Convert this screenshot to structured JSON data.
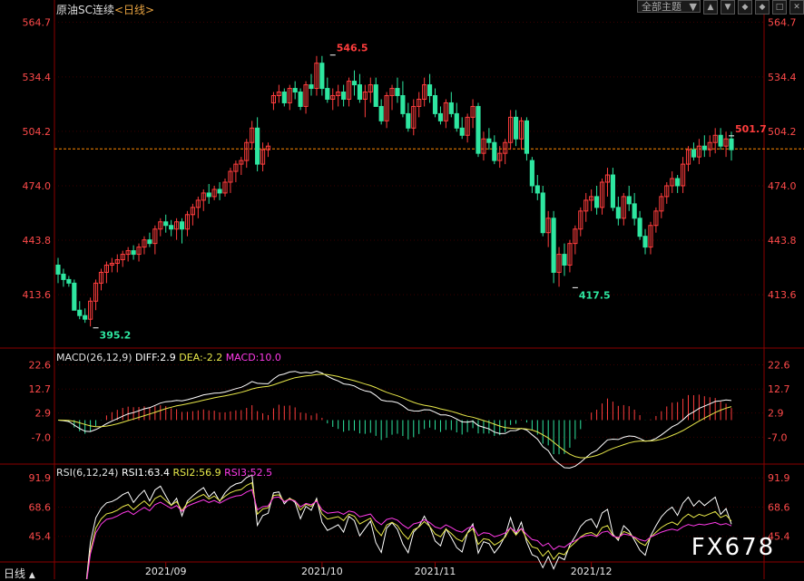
{
  "header": {
    "instrument": "原油SC连续",
    "period": "<日线>",
    "theme_select": "全部主题",
    "theme_arrow": "▼",
    "buttons": [
      "▲",
      "▼",
      "◆",
      "◆",
      "□",
      "✕"
    ]
  },
  "period_tab": "日线",
  "watermark": "FX678",
  "colors": {
    "up": "#ff3d3d",
    "down": "#2ee6a0",
    "bg": "#000000",
    "grid": "#3a0000",
    "axis_text": "#ff4a4a",
    "last_price_line": "#ff8a00"
  },
  "chart_data": [
    {
      "type": "candlestick",
      "title": "原油SC连续<日线>",
      "y_ticks": [
        564.7,
        534.4,
        504.2,
        474.0,
        443.8,
        413.6
      ],
      "ylim": [
        384.0,
        570.0
      ],
      "x_labels": [
        "2021/09",
        "2021/10",
        "2021/11",
        "2021/12"
      ],
      "x_label_index": [
        20,
        49,
        70,
        99
      ],
      "annotations": [
        {
          "text": "546.5",
          "index": 51,
          "value": 546.5,
          "kind": "high"
        },
        {
          "text": "395.2",
          "index": 7,
          "value": 395.2,
          "kind": "low"
        },
        {
          "text": "417.5",
          "index": 96,
          "value": 417.5,
          "kind": "low"
        },
        {
          "text": "501.7",
          "index": 125,
          "value": 501.7,
          "kind": "high"
        }
      ],
      "last_price": 494.5,
      "candles": [
        [
          430,
          434,
          420,
          425
        ],
        [
          425,
          428,
          418,
          422
        ],
        [
          422,
          424,
          418,
          420
        ],
        [
          420,
          422,
          405,
          405
        ],
        [
          405,
          410,
          400,
          402
        ],
        [
          402,
          406,
          398,
          400
        ],
        [
          400,
          412,
          396,
          410
        ],
        [
          410,
          422,
          405,
          420
        ],
        [
          420,
          428,
          416,
          426
        ],
        [
          426,
          432,
          420,
          430
        ],
        [
          430,
          434,
          426,
          431
        ],
        [
          431,
          436,
          426,
          433
        ],
        [
          433,
          438,
          429,
          436
        ],
        [
          436,
          440,
          432,
          438
        ],
        [
          438,
          441,
          433,
          436
        ],
        [
          436,
          442,
          432,
          440
        ],
        [
          440,
          446,
          436,
          444
        ],
        [
          444,
          448,
          440,
          442
        ],
        [
          442,
          452,
          436,
          450
        ],
        [
          450,
          456,
          446,
          454
        ],
        [
          454,
          458,
          448,
          452
        ],
        [
          452,
          455,
          446,
          450
        ],
        [
          450,
          456,
          444,
          454
        ],
        [
          454,
          456,
          442,
          450
        ],
        [
          450,
          460,
          446,
          458
        ],
        [
          458,
          464,
          452,
          462
        ],
        [
          462,
          468,
          456,
          466
        ],
        [
          466,
          472,
          460,
          470
        ],
        [
          470,
          475,
          464,
          468
        ],
        [
          468,
          474,
          466,
          472
        ],
        [
          472,
          476,
          466,
          470
        ],
        [
          470,
          478,
          468,
          476
        ],
        [
          476,
          484,
          470,
          482
        ],
        [
          482,
          488,
          476,
          486
        ],
        [
          486,
          490,
          480,
          488
        ],
        [
          488,
          500,
          484,
          498
        ],
        [
          498,
          510,
          494,
          506
        ],
        [
          506,
          512,
          482,
          486
        ],
        [
          486,
          498,
          482,
          494
        ],
        [
          494,
          498,
          490,
          496
        ],
        [
          520,
          526,
          516,
          524
        ],
        [
          524,
          530,
          520,
          526
        ],
        [
          526,
          528,
          518,
          520
        ],
        [
          520,
          530,
          516,
          528
        ],
        [
          528,
          532,
          522,
          526
        ],
        [
          526,
          528,
          516,
          518
        ],
        [
          518,
          532,
          514,
          530
        ],
        [
          530,
          536,
          524,
          528
        ],
        [
          528,
          546,
          524,
          542
        ],
        [
          542,
          546,
          524,
          528
        ],
        [
          528,
          534,
          520,
          522
        ],
        [
          522,
          528,
          516,
          524
        ],
        [
          524,
          530,
          518,
          526
        ],
        [
          526,
          530,
          518,
          522
        ],
        [
          522,
          534,
          518,
          532
        ],
        [
          532,
          538,
          524,
          530
        ],
        [
          530,
          536,
          520,
          522
        ],
        [
          522,
          530,
          512,
          526
        ],
        [
          526,
          534,
          520,
          530
        ],
        [
          530,
          534,
          518,
          518
        ],
        [
          518,
          522,
          508,
          510
        ],
        [
          510,
          526,
          506,
          524
        ],
        [
          524,
          530,
          516,
          528
        ],
        [
          528,
          534,
          520,
          524
        ],
        [
          524,
          532,
          512,
          514
        ],
        [
          514,
          520,
          504,
          506
        ],
        [
          506,
          522,
          502,
          518
        ],
        [
          518,
          526,
          512,
          522
        ],
        [
          522,
          534,
          518,
          530
        ],
        [
          530,
          536,
          520,
          524
        ],
        [
          524,
          528,
          512,
          514
        ],
        [
          514,
          518,
          508,
          510
        ],
        [
          510,
          522,
          506,
          520
        ],
        [
          520,
          526,
          512,
          514
        ],
        [
          514,
          520,
          504,
          506
        ],
        [
          506,
          512,
          500,
          502
        ],
        [
          502,
          514,
          498,
          512
        ],
        [
          512,
          522,
          506,
          518
        ],
        [
          518,
          520,
          490,
          492
        ],
        [
          492,
          504,
          488,
          500
        ],
        [
          500,
          506,
          494,
          498
        ],
        [
          498,
          502,
          486,
          488
        ],
        [
          488,
          496,
          484,
          492
        ],
        [
          492,
          500,
          486,
          498
        ],
        [
          498,
          516,
          494,
          512
        ],
        [
          512,
          516,
          496,
          500
        ],
        [
          500,
          512,
          494,
          510
        ],
        [
          510,
          512,
          488,
          492
        ],
        [
          488,
          490,
          470,
          474
        ],
        [
          474,
          480,
          466,
          470
        ],
        [
          470,
          474,
          446,
          448
        ],
        [
          448,
          460,
          440,
          456
        ],
        [
          456,
          460,
          420,
          426
        ],
        [
          426,
          440,
          418,
          436
        ],
        [
          436,
          442,
          424,
          430
        ],
        [
          430,
          444,
          426,
          442
        ],
        [
          442,
          452,
          436,
          450
        ],
        [
          450,
          462,
          446,
          460
        ],
        [
          460,
          470,
          454,
          466
        ],
        [
          466,
          472,
          460,
          468
        ],
        [
          468,
          474,
          458,
          462
        ],
        [
          462,
          478,
          458,
          476
        ],
        [
          476,
          484,
          468,
          480
        ],
        [
          480,
          484,
          460,
          462
        ],
        [
          462,
          468,
          452,
          456
        ],
        [
          456,
          470,
          452,
          468
        ],
        [
          468,
          474,
          460,
          464
        ],
        [
          464,
          470,
          452,
          456
        ],
        [
          456,
          460,
          444,
          446
        ],
        [
          446,
          450,
          436,
          440
        ],
        [
          440,
          454,
          436,
          452
        ],
        [
          452,
          462,
          448,
          460
        ],
        [
          460,
          470,
          456,
          468
        ],
        [
          468,
          476,
          464,
          474
        ],
        [
          474,
          482,
          470,
          478
        ],
        [
          478,
          480,
          470,
          474
        ],
        [
          474,
          490,
          470,
          486
        ],
        [
          486,
          496,
          482,
          494
        ],
        [
          494,
          498,
          488,
          490
        ],
        [
          490,
          500,
          486,
          496
        ],
        [
          496,
          502,
          490,
          494
        ],
        [
          494,
          502,
          490,
          498
        ],
        [
          498,
          506,
          492,
          502
        ],
        [
          502,
          506,
          494,
          496
        ],
        [
          496,
          504,
          490,
          500
        ],
        [
          500,
          504,
          488,
          494
        ]
      ]
    },
    {
      "type": "line",
      "title": "MACD(26,12,9)",
      "legend": [
        {
          "name": "DIFF",
          "value": "2.9",
          "color": "#ffffff"
        },
        {
          "name": "DEA",
          "value": "-2.2",
          "color": "#e8e84a"
        },
        {
          "name": "MACD",
          "value": "10.0",
          "color": "#ff3ae8"
        }
      ],
      "y_ticks": [
        22.6,
        12.7,
        2.9,
        -7.0
      ],
      "ylim": [
        -18.0,
        28.0
      ]
    },
    {
      "type": "line",
      "title": "RSI(6,12,24)",
      "legend": [
        {
          "name": "RSI1",
          "value": "63.4",
          "color": "#ffffff"
        },
        {
          "name": "RSI2",
          "value": "56.9",
          "color": "#e8e84a"
        },
        {
          "name": "RSI3",
          "value": "52.5",
          "color": "#ff3ae8"
        }
      ],
      "y_ticks": [
        91.9,
        68.6,
        45.4
      ],
      "ylim": [
        25.0,
        100.0
      ]
    }
  ]
}
